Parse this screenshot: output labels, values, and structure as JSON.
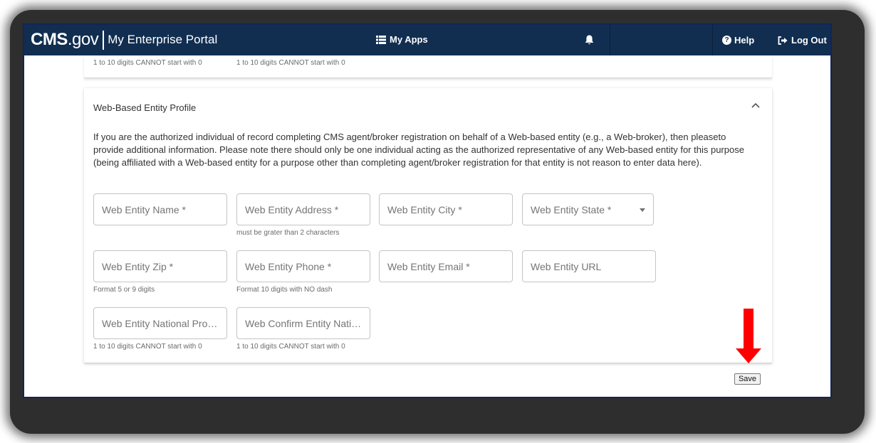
{
  "header": {
    "brand_cms": "CMS",
    "brand_gov": ".gov",
    "portal_name": "My Enterprise Portal",
    "my_apps_label": "My Apps",
    "help_label": "Help",
    "logout_label": "Log Out"
  },
  "previous_section": {
    "hint_left": "1 to 10 digits CANNOT start with 0",
    "hint_right": "1 to 10 digits CANNOT start with 0"
  },
  "section": {
    "title": "Web-Based Entity Profile",
    "description": "If you are the authorized individual of record completing CMS agent/broker registration on behalf of a Web-based entity (e.g., a Web-broker), then pleaseto provide additional information. Please note there should only be one individual acting as the authorized representative of any Web-based entity for this purpose (being affiliated with a Web-based entity for a purpose other than completing agent/broker registration for that entity is not reason to enter data here).",
    "fields": {
      "name": {
        "placeholder": "Web Entity Name *"
      },
      "address": {
        "placeholder": "Web Entity Address *",
        "hint": "must be grater than 2 characters"
      },
      "city": {
        "placeholder": "Web Entity City *"
      },
      "state": {
        "placeholder": "Web Entity State *"
      },
      "zip": {
        "placeholder": "Web Entity Zip *",
        "hint": "Format 5 or 9 digits"
      },
      "phone": {
        "placeholder": "Web Entity Phone *",
        "hint": "Format 10 digits with NO dash"
      },
      "email": {
        "placeholder": "Web Entity Email *"
      },
      "url": {
        "placeholder": "Web Entity URL"
      },
      "npn": {
        "placeholder": "Web Entity National Prod...",
        "hint": "1 to 10 digits CANNOT start with 0"
      },
      "confirm_npn": {
        "placeholder": "Web Confirm Entity Natio...",
        "hint": "1 to 10 digits CANNOT start with 0"
      }
    }
  },
  "save_label": "Save",
  "colors": {
    "header_bg": "#112e51",
    "annotation_arrow": "#ff0000"
  },
  "icons": {
    "apps": "list-icon",
    "bell": "bell-icon",
    "help": "question-circle-icon",
    "logout": "sign-out-icon",
    "collapse": "chevron-up-icon",
    "dropdown": "caret-down-icon",
    "annotation": "red-arrow-down-icon"
  }
}
